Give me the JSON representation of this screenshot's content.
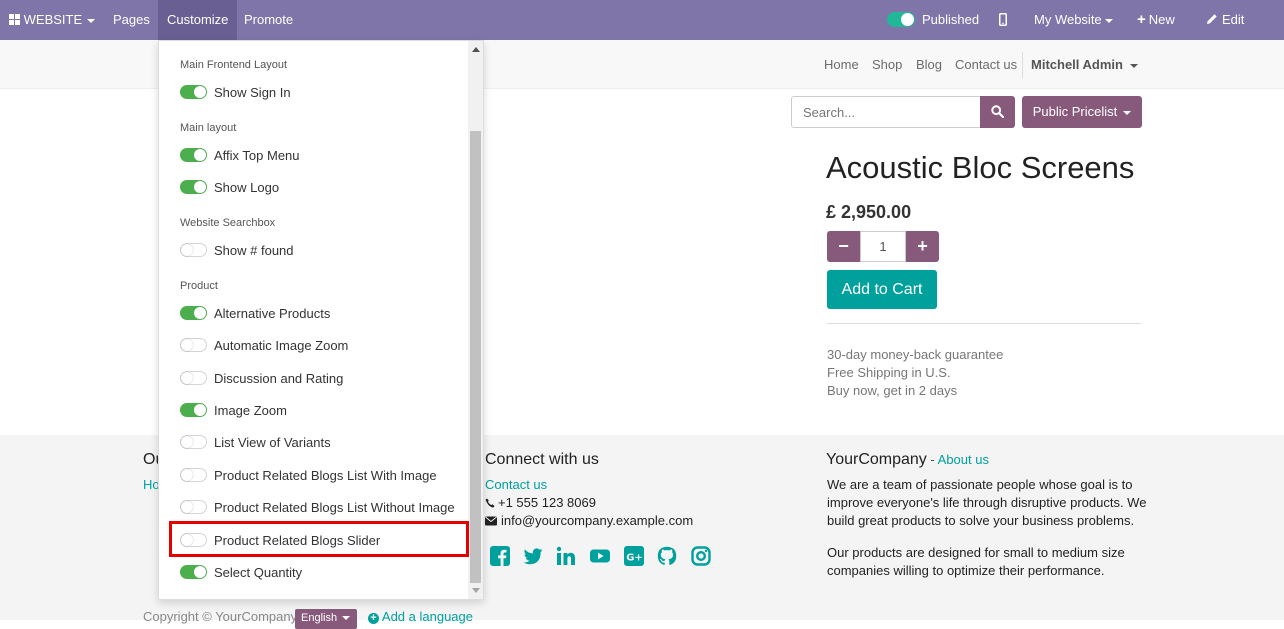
{
  "topbar": {
    "website": "WEBSITE",
    "pages": "Pages",
    "customize": "Customize",
    "promote": "Promote",
    "published": "Published",
    "my_website": "My Website",
    "new": "New",
    "edit": "Edit"
  },
  "nav": {
    "items": [
      "Home",
      "Shop",
      "Blog",
      "Contact us"
    ],
    "user": "Mitchell Admin"
  },
  "search": {
    "placeholder": "Search..."
  },
  "pricelist": "Public Pricelist",
  "product": {
    "title": "Acoustic Bloc Screens",
    "price": "£ 2,950.00",
    "qty": "1",
    "add_to_cart": "Add to Cart",
    "guarantees": [
      "30-day money-back guarantee",
      "Free Shipping in U.S.",
      "Buy now, get in 2 days"
    ]
  },
  "footer": {
    "connect_title": "Connect with us",
    "contact_us": "Contact us",
    "phone": "+1 555 123 8069",
    "email": "info@yourcompany.example.com",
    "company_name": "YourCompany",
    "company_sep": " - ",
    "about_us": "About us",
    "about_p1": [
      "We are a team of passionate people whose goal is to",
      "improve everyone's life through disruptive products. We",
      "build great products to solve your business problems."
    ],
    "about_p2": [
      "Our products are designed for small to medium size",
      "companies willing to optimize their performance."
    ],
    "left_head_partial": "Ou",
    "left_link_partial": "Ho",
    "copyright": "Copyright © YourCompany",
    "language": "English",
    "add_language": "Add a language",
    "social_icons": [
      "facebook-icon",
      "twitter-icon",
      "linkedin-icon",
      "youtube-icon",
      "google-plus-icon",
      "github-icon",
      "instagram-icon"
    ]
  },
  "customize_menu": {
    "sections": [
      {
        "title": "Main Frontend Layout",
        "options": [
          {
            "label": "Show Sign In",
            "on": true
          }
        ]
      },
      {
        "title": "Main layout",
        "options": [
          {
            "label": "Affix Top Menu",
            "on": true
          },
          {
            "label": "Show Logo",
            "on": true
          }
        ]
      },
      {
        "title": "Website Searchbox",
        "options": [
          {
            "label": "Show # found",
            "on": false
          }
        ]
      },
      {
        "title": "Product",
        "options": [
          {
            "label": "Alternative Products",
            "on": true
          },
          {
            "label": "Automatic Image Zoom",
            "on": false
          },
          {
            "label": "Discussion and Rating",
            "on": false
          },
          {
            "label": "Image Zoom",
            "on": true
          },
          {
            "label": "List View of Variants",
            "on": false
          },
          {
            "label": "Product Related Blogs List With Image",
            "on": false
          },
          {
            "label": "Product Related Blogs List Without Image",
            "on": false
          },
          {
            "label": "Product Related Blogs Slider",
            "on": false
          },
          {
            "label": "Select Quantity",
            "on": true
          }
        ]
      }
    ]
  },
  "colors": {
    "topbar": "#8075a8",
    "primary": "#875a7b",
    "accent": "#00a09d",
    "toggle_on": "#4cae4c",
    "highlight": "#e60000"
  }
}
